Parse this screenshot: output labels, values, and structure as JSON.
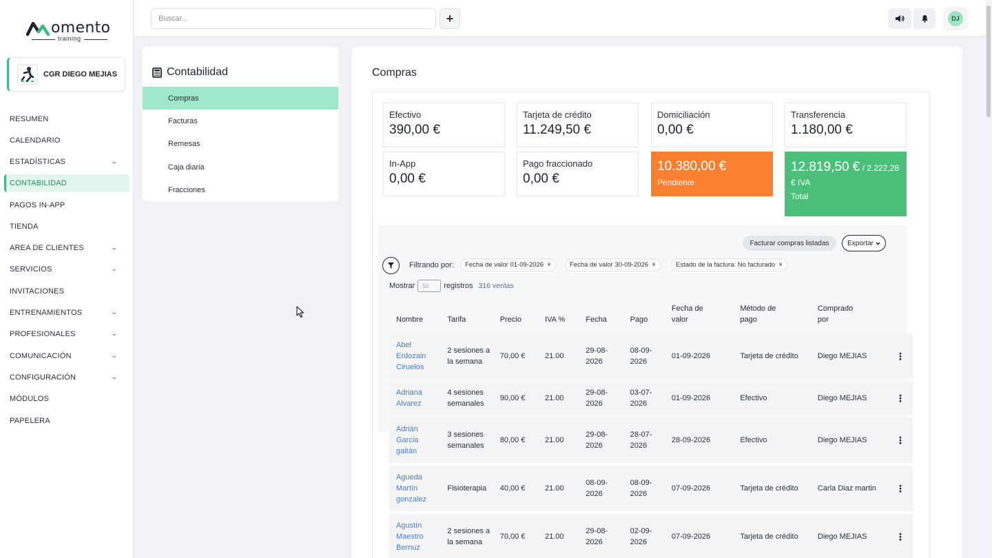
{
  "brand": {
    "name": "omento",
    "sub": "training"
  },
  "club": {
    "name": "CGR DIEGO MEJIAS"
  },
  "sidebar": {
    "items": [
      {
        "label": "RESUMEN",
        "expandable": false
      },
      {
        "label": "CALENDARIO",
        "expandable": false
      },
      {
        "label": "ESTADÍSTICAS",
        "expandable": true
      },
      {
        "label": "CONTABILIDAD",
        "expandable": false,
        "active": true
      },
      {
        "label": "PAGOS IN-APP",
        "expandable": false
      },
      {
        "label": "TIENDA",
        "expandable": false
      },
      {
        "label": "AREA DE CLIENTES",
        "expandable": true
      },
      {
        "label": "SERVICIOS",
        "expandable": true
      },
      {
        "label": "INVITACIONES",
        "expandable": false
      },
      {
        "label": "ENTRENAMIENTOS",
        "expandable": true
      },
      {
        "label": "PROFESIONALES",
        "expandable": true
      },
      {
        "label": "COMUNICACIÓN",
        "expandable": true
      },
      {
        "label": "CONFIGURACIÓN",
        "expandable": true
      },
      {
        "label": "MÓDULOS",
        "expandable": false
      },
      {
        "label": "PAPELERA",
        "expandable": false
      }
    ]
  },
  "topbar": {
    "search_placeholder": "Buscar...",
    "avatar_initials": "DJ"
  },
  "submenu": {
    "title": "Contabilidad",
    "items": [
      "Compras",
      "Facturas",
      "Remesas",
      "Caja diaria",
      "Fracciones"
    ],
    "active_index": 0
  },
  "main": {
    "title": "Compras",
    "stats": {
      "efectivo": {
        "label": "Efectivo",
        "value": "390,00 €"
      },
      "tarjeta": {
        "label": "Tarjeta de crédito",
        "value": "11.249,50 €"
      },
      "domiciliacion": {
        "label": "Domiciliación",
        "value": "0,00 €"
      },
      "transferencia": {
        "label": "Transferencia",
        "value": "1.180,00 €"
      },
      "inapp": {
        "label": "In-App",
        "value": "0,00 €"
      },
      "fraccionado": {
        "label": "Pago fraccionado",
        "value": "0,00 €"
      },
      "pendiente": {
        "value": "10.380,00 €",
        "label": "Pendiente"
      },
      "total": {
        "value": "12.819,50 €",
        "iva_part1": " / 2.222,28",
        "iva_part2": "€ IVA",
        "label": "Total"
      }
    },
    "buttons": {
      "facturar": "Facturar compras listadas",
      "exportar": "Exportar"
    },
    "filter": {
      "label": "Filtrando por:",
      "chips": [
        "Fecha de valor 01-09-2026",
        "Fecha de valor 30-09-2026",
        "Estado de la factura: No facturado"
      ]
    },
    "show": {
      "prefix": "Mostrar",
      "value": "50",
      "suffix": "registros",
      "count": "316 ventas"
    },
    "table": {
      "headers": [
        "Nombre",
        "Tarifa",
        "Precio",
        "IVA %",
        "Fecha",
        "Pago",
        "Fecha de valor",
        "Método de pago",
        "Comprado por"
      ],
      "rows": [
        [
          "Abel Erdozain Ciruelos",
          "2 sesiones a la semana",
          "70,00 €",
          "21.00",
          "29-08-2026",
          "08-09-2026",
          "01-09-2026",
          "Tarjeta de crédito",
          "Diego MEJIAS"
        ],
        [
          "Adriana Alvarez",
          "4 sesiones semanales",
          "90,00 €",
          "21.00",
          "29-08-2026",
          "03-07-2026",
          "01-09-2026",
          "Efectivo",
          "Diego MEJIAS"
        ],
        [
          "Adrián Garcia gaitán",
          "3 sesiones semanales",
          "80,00 €",
          "21.00",
          "29-08-2026",
          "28-07-2026",
          "28-09-2026",
          "Efectivo",
          "Diego MEJIAS"
        ],
        [
          "Agueda Martín gonzalez",
          "Fisioterapia",
          "40,00 €",
          "21.00",
          "08-09-2026",
          "08-09-2026",
          "07-09-2026",
          "Tarjeta de crédito",
          "Carla Diaz martin"
        ],
        [
          "Agustín Maestro Bernuz",
          "2 sesiones a la semana",
          "70,00 €",
          "21.00",
          "29-08-2026",
          "02-09-2026",
          "07-09-2026",
          "Tarjeta de crédito",
          "Diego MEJIAS"
        ]
      ]
    }
  },
  "colors": {
    "accent": "#3fb984",
    "pending": "#fb8130",
    "total": "#4cc07a",
    "link": "#4a7fc1"
  }
}
